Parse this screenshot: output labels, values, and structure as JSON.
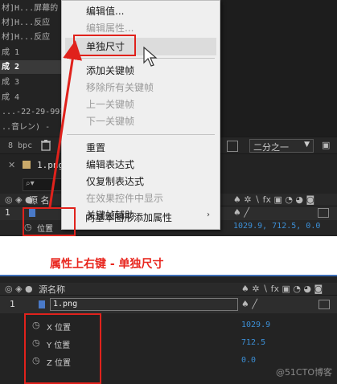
{
  "project_list": [
    "材]H...屏幕的",
    "材]H...反应",
    "材]H...反应",
    "成 1",
    "成 2",
    "成 3",
    "成 4",
    "...-22-29-991",
    "..音レン) -"
  ],
  "toolbar": {
    "bpc": "8 bpc",
    "zoom_select": "二分之一"
  },
  "comp_tab": "1.png",
  "search_placeholder": "",
  "context_menu": {
    "items": [
      {
        "label": "编辑值...",
        "disabled": false
      },
      {
        "label": "编辑属性...",
        "disabled": true
      },
      {
        "label": "单独尺寸",
        "disabled": false
      },
      {
        "label": "添加关键帧",
        "disabled": false
      },
      {
        "label": "移除所有关键帧",
        "disabled": true
      },
      {
        "label": "上一关键帧",
        "disabled": true
      },
      {
        "label": "下一关键帧",
        "disabled": true
      },
      {
        "label": "重置",
        "disabled": false
      },
      {
        "label": "编辑表达式",
        "disabled": false
      },
      {
        "label": "仅复制表达式",
        "disabled": false
      },
      {
        "label": "在效果控件中显示",
        "disabled": true
      },
      {
        "label": "关键帧辅助",
        "disabled": false,
        "submenu": true
      },
      {
        "label": "向基本图形添加属性",
        "disabled": false
      }
    ]
  },
  "upper_timeline": {
    "header_source": "源 名",
    "layer_index": "1",
    "prop_label": "位置",
    "position_value": "1029.9, 712.5, 0.0"
  },
  "annotation": "属性上右键 - 单独尺寸",
  "lower_timeline": {
    "header_source": "源名称",
    "layer_index": "1",
    "layer_name": "1.png",
    "props": [
      {
        "label": "X 位置",
        "value": "1029.9"
      },
      {
        "label": "Y 位置",
        "value": "712.5"
      },
      {
        "label": "Z 位置",
        "value": "0.0"
      }
    ]
  },
  "watermark": "@51CTO博客",
  "colors": {
    "accent_red": "#e0221c",
    "value_blue": "#3c8fd6"
  }
}
